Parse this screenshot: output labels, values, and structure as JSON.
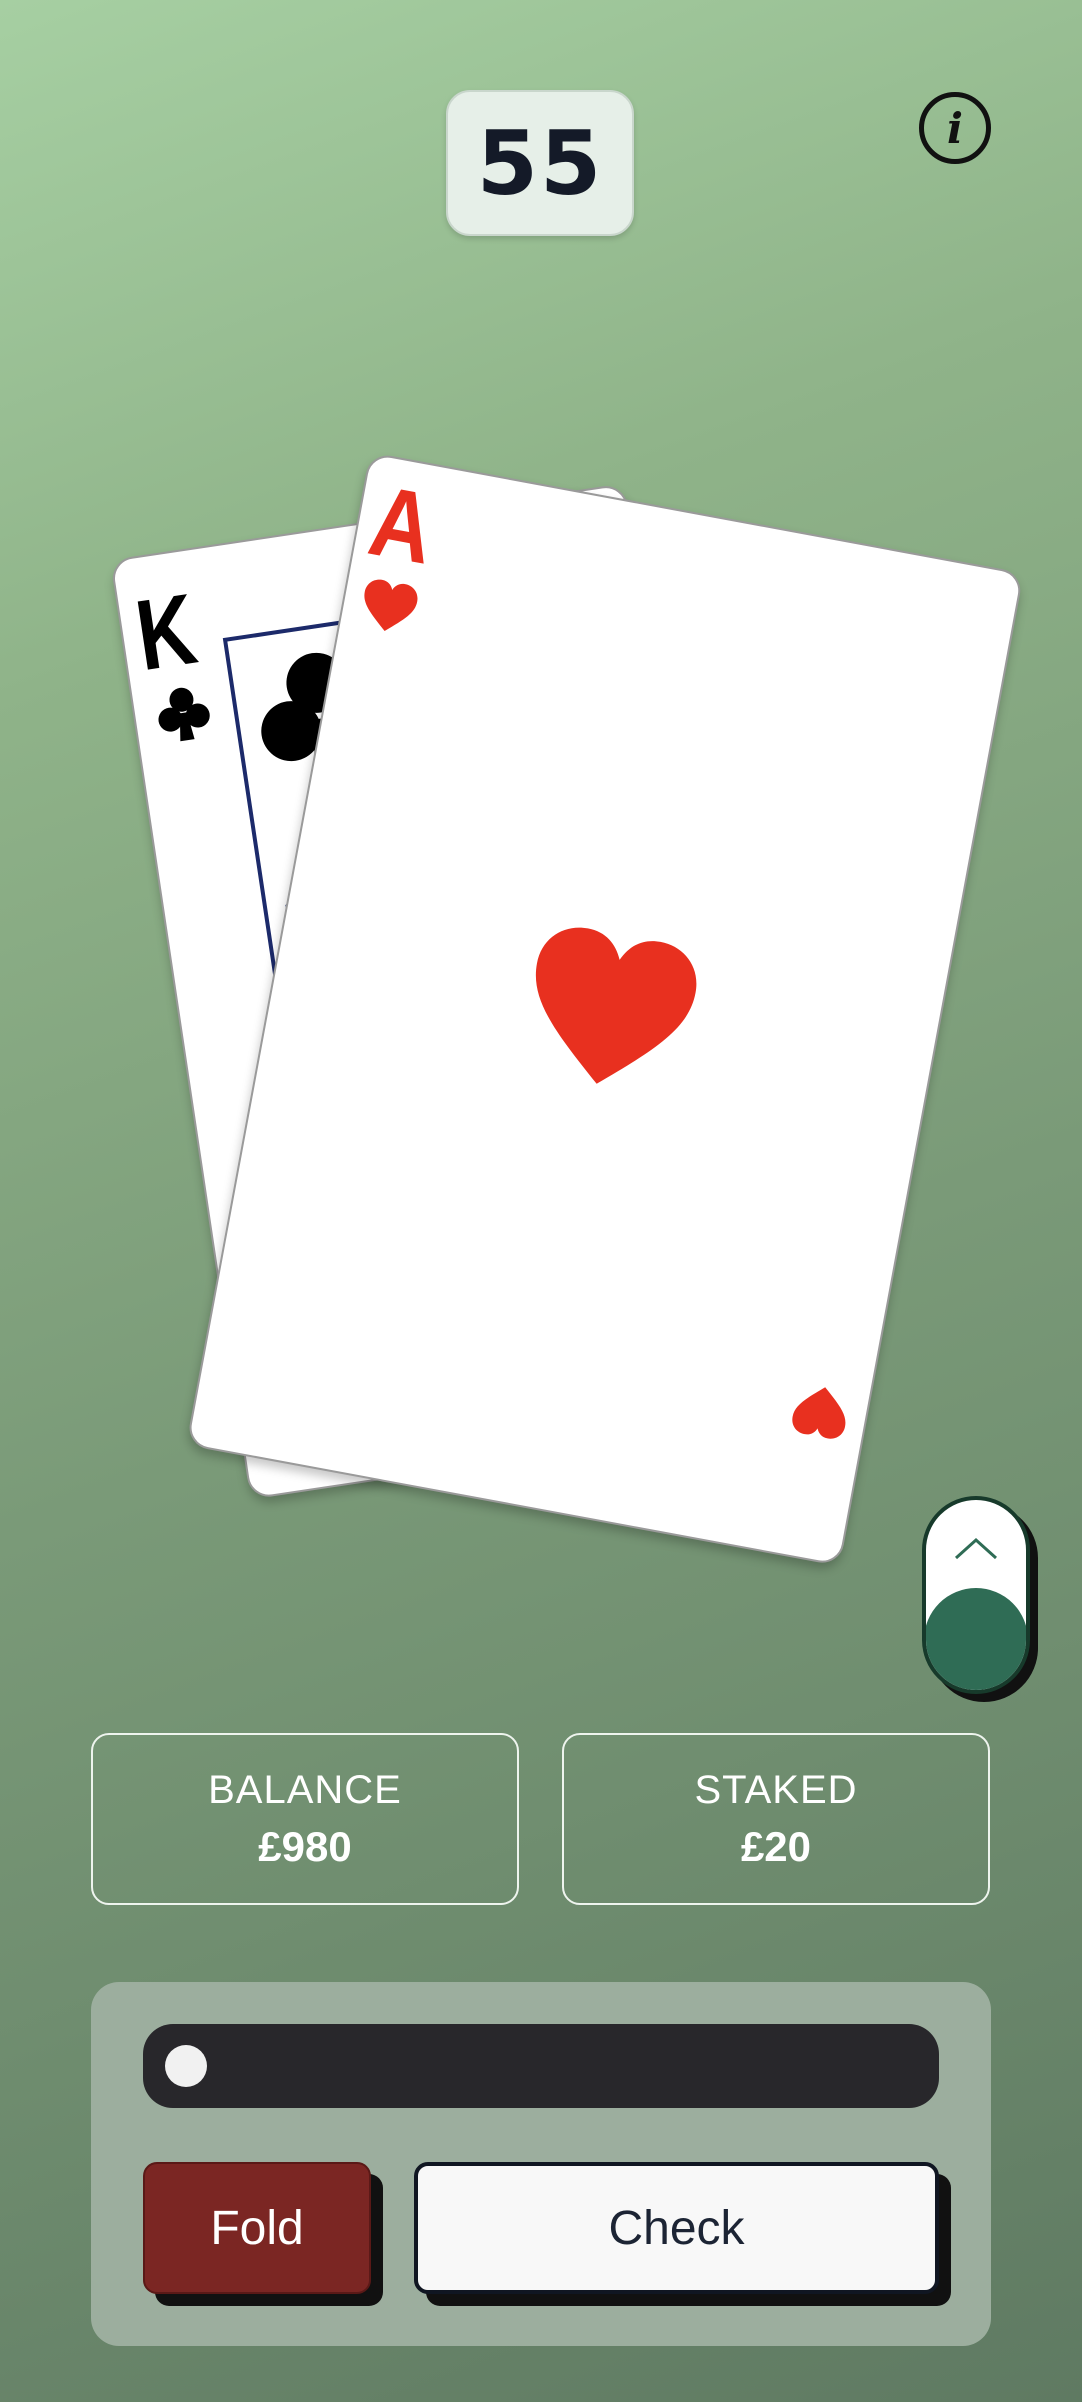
{
  "timer": {
    "value": "55"
  },
  "info": {
    "glyph": "i"
  },
  "hand": {
    "cards": [
      {
        "rank": "K",
        "suit": "clubs",
        "color": "#000000"
      },
      {
        "rank": "A",
        "suit": "hearts",
        "color": "#e8301f"
      }
    ]
  },
  "stats": {
    "balance_label": "BALANCE",
    "balance_value": "£980",
    "staked_label": "STAKED",
    "staked_value": "£20"
  },
  "bet_slider": {
    "level": 0
  },
  "actions": {
    "fold_label": "Fold",
    "check_label": "Check"
  },
  "colors": {
    "fold": "#7b2623",
    "toggle_knob": "#2f6c55",
    "heart": "#e8301f"
  }
}
